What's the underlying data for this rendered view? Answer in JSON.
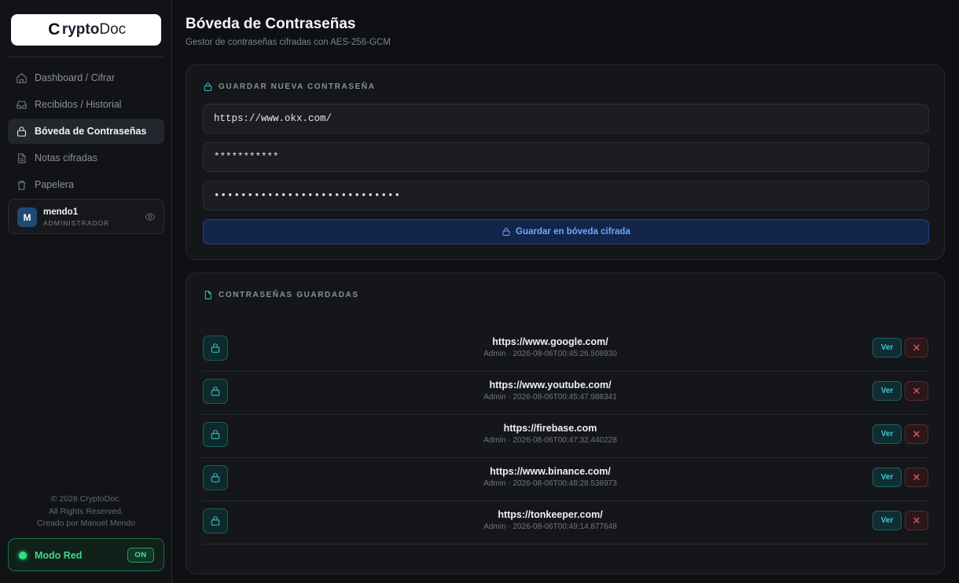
{
  "brand": {
    "logo_prefix": "C",
    "logo_bold": "rypto",
    "logo_rest": "Doc"
  },
  "sidebar": {
    "items": [
      {
        "label": "Dashboard / Cifrar",
        "icon": "home-icon"
      },
      {
        "label": "Recibidos / Historial",
        "icon": "inbox-icon"
      },
      {
        "label": "Bóveda de Contraseñas",
        "icon": "lock-icon",
        "active": true
      },
      {
        "label": "Notas cifradas",
        "icon": "document-icon"
      },
      {
        "label": "Papelera",
        "icon": "trash-icon"
      }
    ],
    "user": {
      "initial": "M",
      "name": "mendo1",
      "role": "ADMINISTRADOR"
    },
    "footer": {
      "line1": "© 2026 CryptoDoc.",
      "line2": "All Rights Reserved.",
      "line3": "Creado por Manuel Mendo"
    },
    "network": {
      "label": "Modo Red",
      "state": "ON"
    }
  },
  "header": {
    "title": "Bóveda de Contraseñas",
    "subtitle": "Gestor de contraseñas cifradas con AES-256-GCM"
  },
  "new_password": {
    "heading": "GUARDAR NUEVA CONTRASEÑA",
    "url_value": "https://www.okx.com/",
    "user_value": "***********",
    "password_value": "••••••••••••••••••••••••••••",
    "save_label": "Guardar en bóveda cifrada"
  },
  "saved": {
    "heading": "CONTRASEÑAS GUARDADAS",
    "view_label": "Ver",
    "delete_label": "✕",
    "items": [
      {
        "site": "https://www.google.com/",
        "meta": "Admin · 2026-08-06T00:45:26.508930"
      },
      {
        "site": "https://www.youtube.com/",
        "meta": "Admin · 2026-08-06T00:45:47.988341"
      },
      {
        "site": "https://firebase.com",
        "meta": "Admin · 2026-08-06T00:47:32.440228"
      },
      {
        "site": "https://www.binance.com/",
        "meta": "Admin · 2026-08-06T00:48:28.538973"
      },
      {
        "site": "https://tonkeeper.com/",
        "meta": "Admin · 2026-08-06T00:49:14.877648"
      }
    ]
  },
  "colors": {
    "accent_teal": "#34c3cf",
    "accent_blue": "#6ea8ff",
    "accent_green": "#3fd68c",
    "danger": "#f05b64"
  }
}
